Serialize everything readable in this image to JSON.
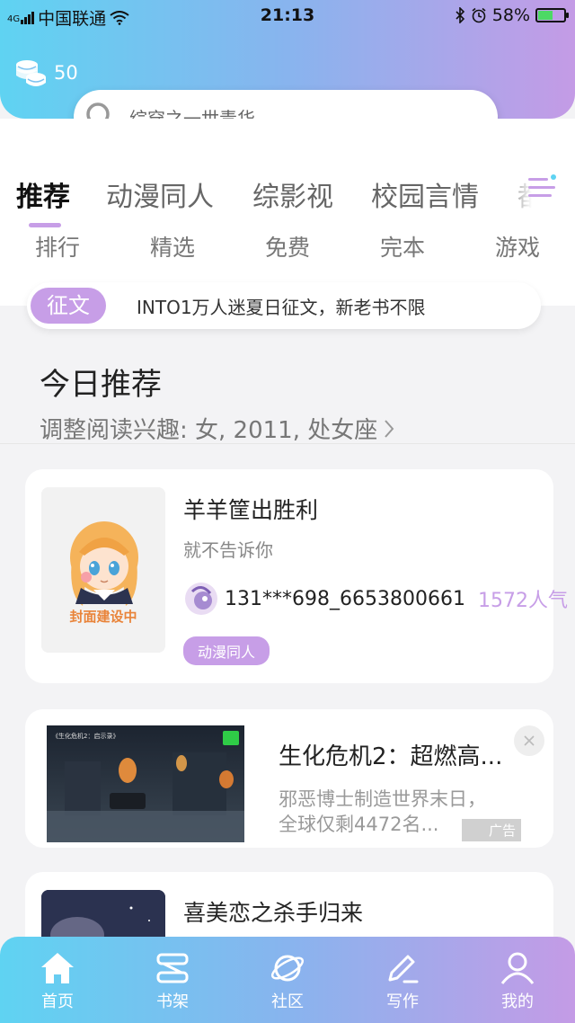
{
  "status_bar": {
    "carrier_net": "4G",
    "carrier": "中国联通",
    "time": "21:13",
    "battery": "58%",
    "battery_level": 0.58,
    "icons": [
      "wifi-icon",
      "bluetooth-icon",
      "alarm-icon",
      "battery-icon"
    ]
  },
  "header": {
    "coins": "50",
    "search_placeholder": "综穿之一世青华"
  },
  "tabs": [
    {
      "label": "推荐",
      "active": true
    },
    {
      "label": "动漫同人"
    },
    {
      "label": "综影视"
    },
    {
      "label": "校园言情"
    },
    {
      "label": "都市"
    }
  ],
  "subnav": [
    "排行",
    "精选",
    "免费",
    "完本",
    "游戏"
  ],
  "notice": {
    "tag": "征文",
    "text": "INTO1万人迷夏日征文，新老书不限"
  },
  "recommend": {
    "title": "今日推荐",
    "subtitle": "调整阅读兴趣: 女, 2011, 处女座"
  },
  "book_card": {
    "cover_text": "封面建设中",
    "title": "羊羊筐出胜利",
    "author": "就不告诉你",
    "user": "131***698_6653800661",
    "popularity": "1572人气",
    "tag": "动漫同人"
  },
  "ad_card": {
    "image_caption": "《生化危机2：启示录》",
    "title": "生化危机2：超燃高...",
    "desc": "邪恶博士制造世界末日，全球仅剩4472名...",
    "label": "广告"
  },
  "book_card_2": {
    "title": "喜美恋之杀手归来"
  },
  "bottom_nav": [
    {
      "label": "首页",
      "icon": "home-icon",
      "active": true
    },
    {
      "label": "书架",
      "icon": "bookshelf-icon"
    },
    {
      "label": "社区",
      "icon": "planet-icon"
    },
    {
      "label": "写作",
      "icon": "pen-icon"
    },
    {
      "label": "我的",
      "icon": "user-icon"
    }
  ],
  "colors": {
    "accent_purple": "#c79ee7",
    "gradient_start": "#5fd3f2",
    "gradient_end": "#c49be6"
  }
}
